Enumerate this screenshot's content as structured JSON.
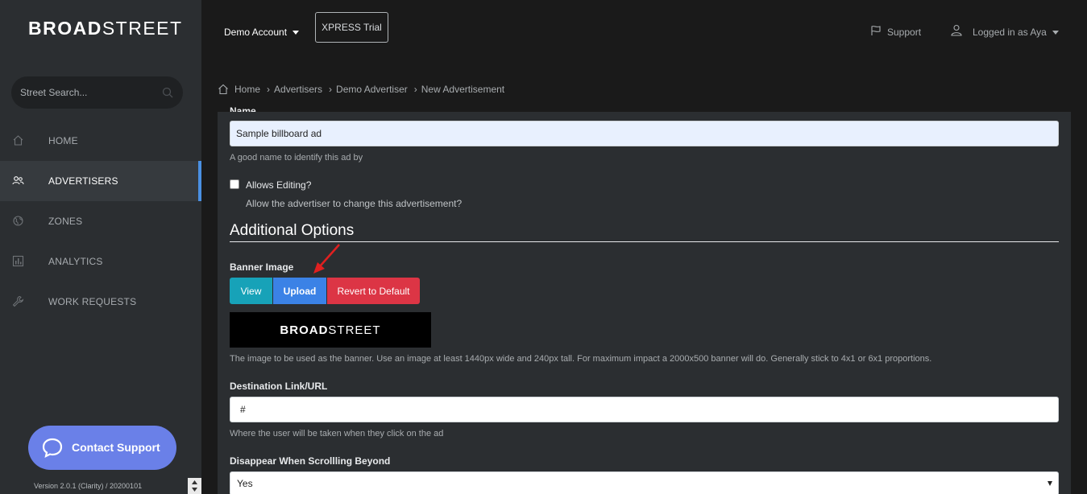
{
  "brand": {
    "logo_bold": "BROAD",
    "logo_light": "STREET"
  },
  "search": {
    "placeholder": "Street Search..."
  },
  "sidebar": {
    "items": [
      {
        "label": "HOME",
        "icon": "home-icon",
        "active": false
      },
      {
        "label": "ADVERTISERS",
        "icon": "users-icon",
        "active": true
      },
      {
        "label": "ZONES",
        "icon": "globe-icon",
        "active": false
      },
      {
        "label": "ANALYTICS",
        "icon": "bar-chart-icon",
        "active": false
      },
      {
        "label": "WORK REQUESTS",
        "icon": "wrench-icon",
        "active": false
      }
    ],
    "contact_label": "Contact Support",
    "version": "Version 2.0.1 (Clarity) / 20200101"
  },
  "topbar": {
    "account": "Demo Account",
    "trial": "XPRESS Trial",
    "support": "Support",
    "user": "Logged in as Aya"
  },
  "breadcrumb": [
    "Home",
    "Advertisers",
    "Demo Advertiser",
    "New Advertisement"
  ],
  "form": {
    "name_label": "Name",
    "name_value": "Sample billboard ad",
    "name_help": "A good name to identify this ad by",
    "allows_editing_label": "Allows Editing?",
    "allows_editing_help": "Allow the advertiser to change this advertisement?",
    "allows_editing_checked": false,
    "section_title": "Additional Options",
    "banner_label": "Banner Image",
    "btn_view": "View",
    "btn_upload": "Upload",
    "btn_revert": "Revert to Default",
    "banner_preview_bold": "BROAD",
    "banner_preview_light": "STREET",
    "banner_help": "The image to be used as the banner. Use an image at least 1440px wide and 240px tall. For maximum impact a 2000x500 banner will do. Generally stick to 4x1 or 6x1 proportions.",
    "url_label": "Destination Link/URL",
    "url_value": "#",
    "url_help": "Where the user will be taken when they click on the ad",
    "disappear_label": "Disappear When Scrollling Beyond",
    "disappear_value": "Yes"
  },
  "colors": {
    "sidebar_bg": "#2b2e31",
    "page_bg": "#1a1a1a",
    "active_accent": "#4a90e2",
    "contact_bg": "#6a80e8",
    "view_btn": "#17a2b8",
    "upload_btn": "#3b82e6",
    "revert_btn": "#dc3545",
    "annotation_arrow": "#e02020"
  }
}
